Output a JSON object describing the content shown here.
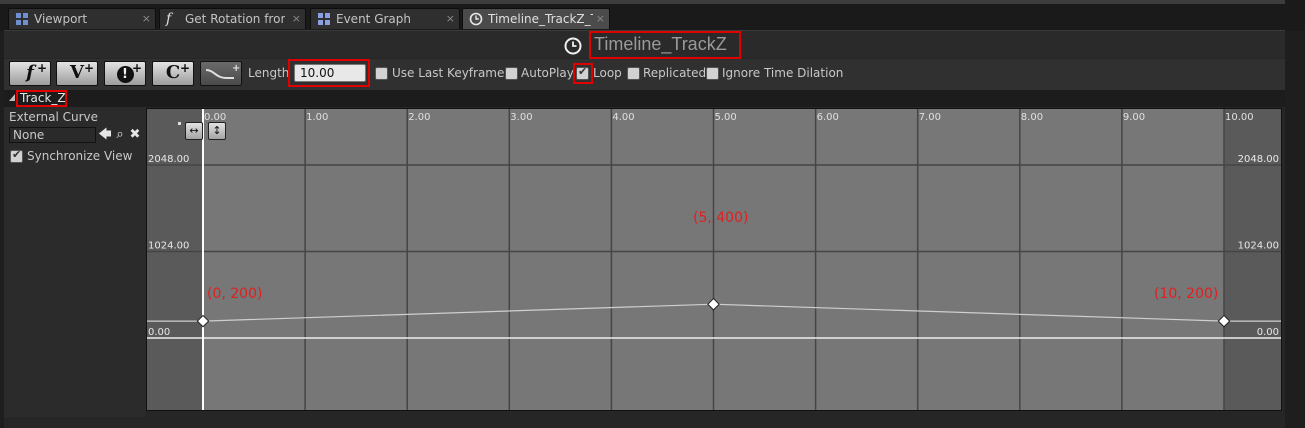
{
  "tabs": [
    {
      "label": "Viewport",
      "icon": "viewport-grid-icon"
    },
    {
      "label": "Get Rotation from l",
      "icon": "function-icon"
    },
    {
      "label": "Event Graph",
      "icon": "event-graph-icon"
    },
    {
      "label": "Timeline_TrackZ_Te",
      "icon": "clock-icon",
      "active": true
    }
  ],
  "tab_close_glyph": "×",
  "header": {
    "title": "Timeline_TrackZ",
    "icon": "clock-icon"
  },
  "toolbar": {
    "buttons": [
      {
        "glyph": "f",
        "icon": "add-float-track-icon"
      },
      {
        "glyph": "V",
        "icon": "add-vector-track-icon"
      },
      {
        "glyph": "!",
        "icon": "add-event-track-icon"
      },
      {
        "glyph": "C",
        "icon": "add-color-track-icon"
      },
      {
        "glyph": "",
        "icon": "add-external-curve-icon"
      }
    ],
    "length_label": "Length",
    "length_value": "10.00",
    "checkboxes": [
      {
        "label": "Use Last Keyframe?",
        "checked": false
      },
      {
        "label": "AutoPlay",
        "checked": false
      },
      {
        "label": "Loop",
        "checked": true
      },
      {
        "label": "Replicated",
        "checked": false
      },
      {
        "label": "Ignore Time Dilation",
        "checked": false
      }
    ]
  },
  "track": {
    "name": "Track_Z",
    "external_curve_label": "External Curve",
    "external_curve_value": "None",
    "synchronize_label": "Synchronize View",
    "synchronize_checked": true
  },
  "chart_data": {
    "type": "line",
    "x_ticks": [
      "0.00",
      "1.00",
      "2.00",
      "3.00",
      "4.00",
      "5.00",
      "6.00",
      "7.00",
      "8.00",
      "9.00",
      "10.00"
    ],
    "y_ticks": [
      "2048.00",
      "1024.00",
      "0.00"
    ],
    "y_tick_values": [
      2048,
      1024,
      0
    ],
    "xlim": [
      0,
      10
    ],
    "series": [
      {
        "x": [
          0,
          5,
          10
        ],
        "y": [
          200,
          400,
          200
        ]
      }
    ],
    "annotations": [
      "(0, 200)",
      "(5, 400)",
      "(10, 200)"
    ],
    "colors": {
      "curve": "#cfcfcf",
      "key": "#ffffff",
      "annotation": "#e02020",
      "background": "#777777",
      "outside": "#5a5a5a",
      "grid": "#454545"
    }
  }
}
